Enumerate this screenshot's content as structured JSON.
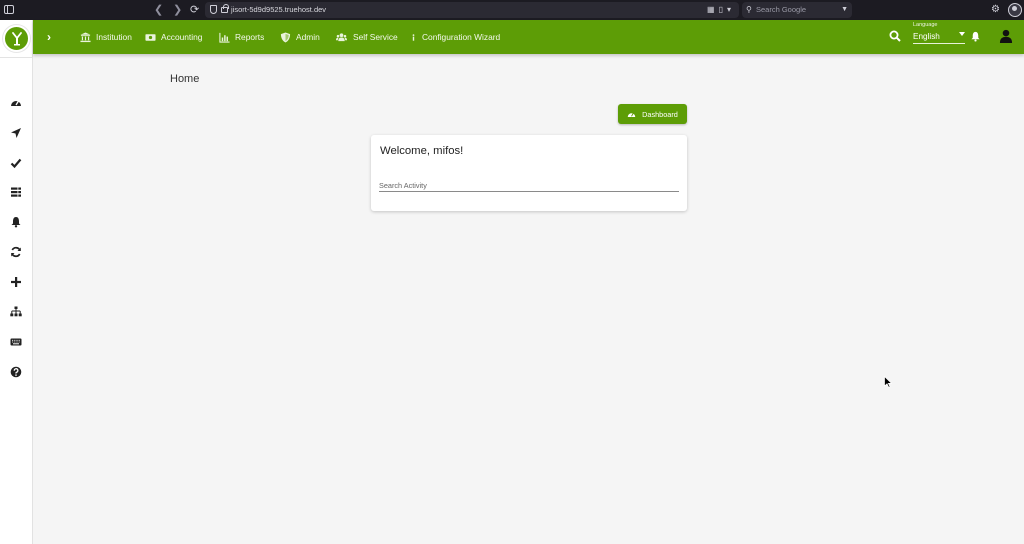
{
  "browser": {
    "url": "jisort-5d9d9525.truehost.dev",
    "search_placeholder": "Search Google"
  },
  "app": {
    "nav": {
      "items": [
        {
          "label": "Institution",
          "icon": "institution-icon"
        },
        {
          "label": "Accounting",
          "icon": "money-icon"
        },
        {
          "label": "Reports",
          "icon": "chart-icon"
        },
        {
          "label": "Admin",
          "icon": "shield-icon"
        },
        {
          "label": "Self Service",
          "icon": "users-icon"
        },
        {
          "label": "Configuration Wizard",
          "icon": "info-icon"
        }
      ],
      "language_label": "Language",
      "language_value": "English"
    },
    "sidebar": {
      "icons": [
        "dashboard-icon",
        "navigation-icon",
        "check-icon",
        "list-icon",
        "bell-icon",
        "sync-icon",
        "plus-icon",
        "sitemap-icon",
        "keyboard-icon",
        "help-icon"
      ]
    },
    "colors": {
      "brand": "#5d9d06"
    }
  },
  "main": {
    "page_title": "Home",
    "dashboard_button": "Dashboard",
    "welcome": "Welcome, mifos!",
    "search_placeholder": "Search Activity"
  }
}
